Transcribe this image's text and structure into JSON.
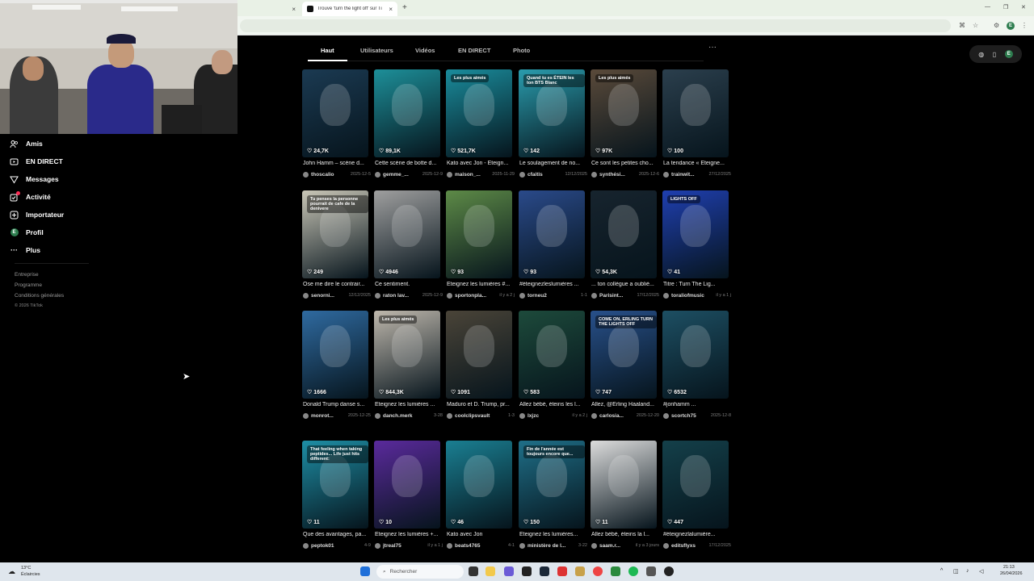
{
  "browser": {
    "tabs": [
      {
        "title": ""
      },
      {
        "title": "Trouve 'turn the light off' sur Ti"
      }
    ]
  },
  "nav": {
    "items": [
      {
        "label": "Amis",
        "icon": "friends-icon"
      },
      {
        "label": "EN DIRECT",
        "icon": "live-icon"
      },
      {
        "label": "Messages",
        "icon": "messages-icon"
      },
      {
        "label": "Activité",
        "icon": "activity-icon"
      },
      {
        "label": "Importateur",
        "icon": "upload-icon"
      },
      {
        "label": "Profil",
        "icon": "profile-avatar"
      },
      {
        "label": "Plus",
        "icon": "more-icon"
      }
    ],
    "profile_initial": "E",
    "footer": {
      "links": [
        "Entreprise",
        "Programme",
        "Conditions générales"
      ],
      "copyright": "© 2026 TikTok"
    }
  },
  "search_tabs": [
    "Haut",
    "Utilisateurs",
    "Vidéos",
    "EN DIRECT",
    "Photo"
  ],
  "results": [
    {
      "likes": "24,7K",
      "title": "John Hamm – scène d...",
      "user": "thoscalio",
      "date": "2025-12-5",
      "color": "#1b3a52",
      "badge": ""
    },
    {
      "likes": "89,1K",
      "title": "Cette scène de botte d...",
      "user": "gemme_...",
      "date": "2025-12-9",
      "color": "#1d8f99",
      "badge": ""
    },
    {
      "likes": "521,7K",
      "title": "Kato avec Jon - Éteign...",
      "user": "maison_...",
      "date": "2025-11-29",
      "color": "#1a8c9c",
      "badge": "Les plus aimés"
    },
    {
      "likes": "142",
      "title": "Le soulagement de no...",
      "user": "cfaitis",
      "date": "12/12/2025",
      "color": "#2a9cad",
      "badge": "Quand tu es ÉTEIN les ton BTS Blanc"
    },
    {
      "likes": "97K",
      "title": "Ce sont les petites cho...",
      "user": "synthési...",
      "date": "2025-12-6",
      "color": "#5a4a3a",
      "badge": "Les plus aimés"
    },
    {
      "likes": "100",
      "title": "La tendance « Éteigne...",
      "user": "trainwit...",
      "date": "27/12/2025",
      "color": "#2b3f4d",
      "badge": ""
    },
    {
      "likes": "249",
      "title": "Ose me dire le contrair...",
      "user": "senorni...",
      "date": "12/12/2025",
      "color": "#c9c6b7",
      "badge": "Tu penses la personne pourrait de cafe de la denivere"
    },
    {
      "likes": "4946",
      "title": "Ce sentiment.",
      "user": "raton lav...",
      "date": "2025-12-9",
      "color": "#9f9f9f",
      "badge": ""
    },
    {
      "likes": "93",
      "title": "Éteignez les lumières #...",
      "user": "sportonpla...",
      "date": "il y a 2 j",
      "color": "#5d8a47",
      "badge": ""
    },
    {
      "likes": "93",
      "title": "#éteignezleslumières ...",
      "user": "torneu2",
      "date": "1-1",
      "color": "#2a4a8a",
      "badge": ""
    },
    {
      "likes": "54,3K",
      "title": "... ton collègue a oublié...",
      "user": "Parisint...",
      "date": "17/12/2025",
      "color": "#17242e",
      "badge": ""
    },
    {
      "likes": "41",
      "title": "Titre : Turn The Lig...",
      "user": "toraliofmusic",
      "date": "il y a 1 j",
      "color": "#1f3fb0",
      "badge": "LIGHTS OFF"
    },
    {
      "likes": "1666",
      "title": "Donald Trump danse s...",
      "user": "monrot...",
      "date": "2025-12-25",
      "color": "#2f6aa0",
      "badge": ""
    },
    {
      "likes": "844,3K",
      "title": "Éteignez les lumières ...",
      "user": "danch.merk",
      "date": "3-28",
      "color": "#bfb8ad",
      "badge": "Les plus aimés"
    },
    {
      "likes": "1091",
      "title": "Maduro et D. Trump, pr...",
      "user": "coolclipsvault",
      "date": "1-3",
      "color": "#4a4438",
      "badge": ""
    },
    {
      "likes": "583",
      "title": "Allez bébé, éteins les l...",
      "user": "lxjzc",
      "date": "il y a 2 j",
      "color": "#1d4a3b",
      "badge": ""
    },
    {
      "likes": "747",
      "title": "Allez, @Erling Haaland...",
      "user": "carlosia...",
      "date": "2025-12-20",
      "color": "#28508a",
      "badge": "COME ON, ERLING TURN THE LIGHTS OFF"
    },
    {
      "likes": "6532",
      "title": "#jonhamm ...",
      "user": "scortch75",
      "date": "2025-12-8",
      "color": "#1d4f63",
      "badge": ""
    },
    {
      "likes": "11",
      "title": "Que des avantages, pa...",
      "user": "peptok01",
      "date": "4-9",
      "color": "#1e8ea5",
      "badge": "That feeling when taking peptides... Life just hits different:"
    },
    {
      "likes": "10",
      "title": "Éteignez les lumières +...",
      "user": "jtreal75",
      "date": "il y a 1 j",
      "color": "#5a2a9c",
      "badge": ""
    },
    {
      "likes": "46",
      "title": "Kato avec Jon",
      "user": "beats4765",
      "date": "4-1",
      "color": "#1a7f92",
      "badge": ""
    },
    {
      "likes": "150",
      "title": "Éteignez les lumières...",
      "user": "ministère de l...",
      "date": "3-22",
      "color": "#1f6f88",
      "badge": "Fin de l'année est toujours encore que..."
    },
    {
      "likes": "11",
      "title": "Allez bébé, éteins la l...",
      "user": "saam.r...",
      "date": "il y a 3 jours",
      "color": "#dcdcdc",
      "badge": ""
    },
    {
      "likes": "447",
      "title": "#éteignezlalumière...",
      "user": "editsflyxs",
      "date": "17/12/2025",
      "color": "#14404a",
      "badge": ""
    }
  ],
  "taskbar": {
    "search_placeholder": "Rechercher",
    "weather_temp": "13°C",
    "weather_desc": "Éclaircies",
    "time": "21:13",
    "date": "26/04/2026"
  }
}
